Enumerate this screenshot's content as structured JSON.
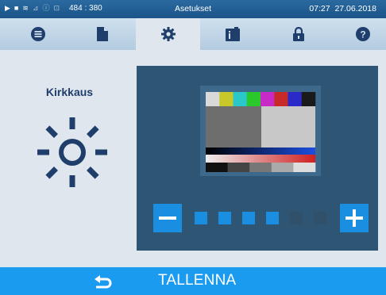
{
  "statusbar": {
    "coords": "484 : 380",
    "title": "Asetukset",
    "time": "07:27",
    "date": "27.06.2018",
    "icons": [
      "play-icon",
      "document-icon",
      "steam-icon",
      "chart-icon",
      "info-icon",
      "lock-icon"
    ]
  },
  "tabs": [
    {
      "icon": "menu-list-icon",
      "active": false
    },
    {
      "icon": "document-icon",
      "active": false
    },
    {
      "icon": "gear-icon",
      "active": true
    },
    {
      "icon": "info-card-icon",
      "active": false
    },
    {
      "icon": "lock-icon",
      "active": false
    },
    {
      "icon": "help-icon",
      "active": false
    }
  ],
  "setting": {
    "label": "Kirkkaus",
    "icon": "sun-icon"
  },
  "brightness": {
    "level": 4,
    "max": 6,
    "decrease_icon": "minus-icon",
    "increase_icon": "plus-icon"
  },
  "test_image": {
    "bars": [
      "#d9d9d9",
      "#c8c82a",
      "#2ac8c8",
      "#2ac82a",
      "#c82ac8",
      "#c82a2a",
      "#2a2ac8",
      "#1a1a1a"
    ],
    "grays": [
      "#111111",
      "#444444",
      "#777777",
      "#aaaaaa",
      "#dddddd"
    ]
  },
  "footer": {
    "save_label": "TALLENNA",
    "back_icon": "back-arrow-icon"
  },
  "colors": {
    "accent": "#1a9bf0",
    "panel": "#2e5674",
    "pip_on": "#1a8ee0",
    "pip_off": "#31506a"
  }
}
